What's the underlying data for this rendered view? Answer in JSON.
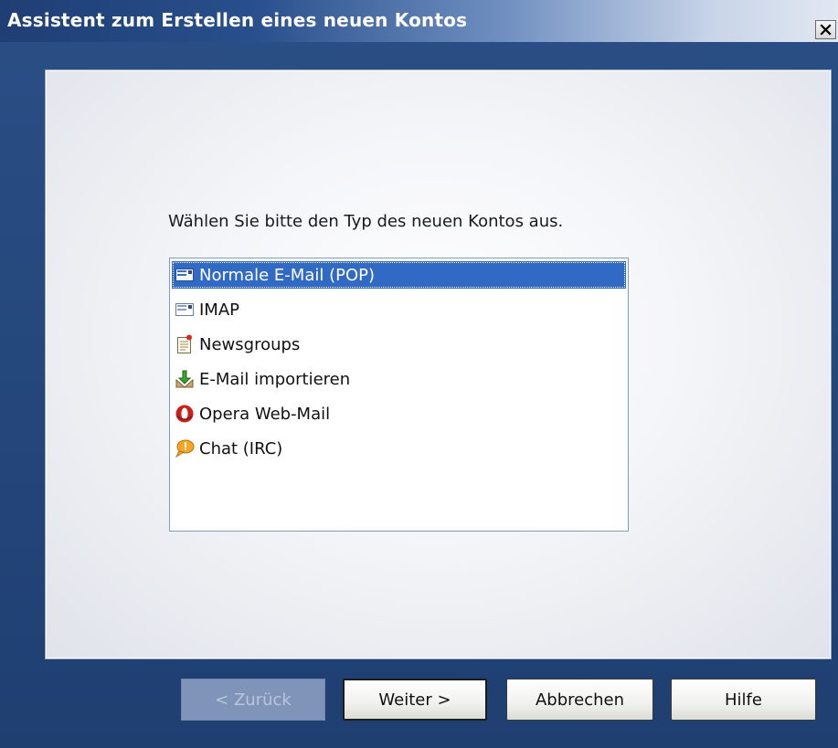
{
  "window": {
    "title": "Assistent zum Erstellen eines neuen Kontos"
  },
  "prompt": "Wählen Sie bitte den Typ des neuen Kontos aus.",
  "account_types": [
    {
      "label": "Normale E-Mail (POP)",
      "icon": "mail-card-icon",
      "selected": true
    },
    {
      "label": "IMAP",
      "icon": "mail-card-icon",
      "selected": false
    },
    {
      "label": "Newsgroups",
      "icon": "news-note-icon",
      "selected": false
    },
    {
      "label": "E-Mail importieren",
      "icon": "import-arrow-icon",
      "selected": false
    },
    {
      "label": "Opera Web-Mail",
      "icon": "opera-logo-icon",
      "selected": false
    },
    {
      "label": "Chat (IRC)",
      "icon": "chat-bubble-icon",
      "selected": false
    }
  ],
  "buttons": {
    "back": "< Zurück",
    "next": "Weiter >",
    "cancel": "Abbrechen",
    "help": "Hilfe"
  },
  "colors": {
    "selection": "#316ac5",
    "frame": "#24467a"
  }
}
